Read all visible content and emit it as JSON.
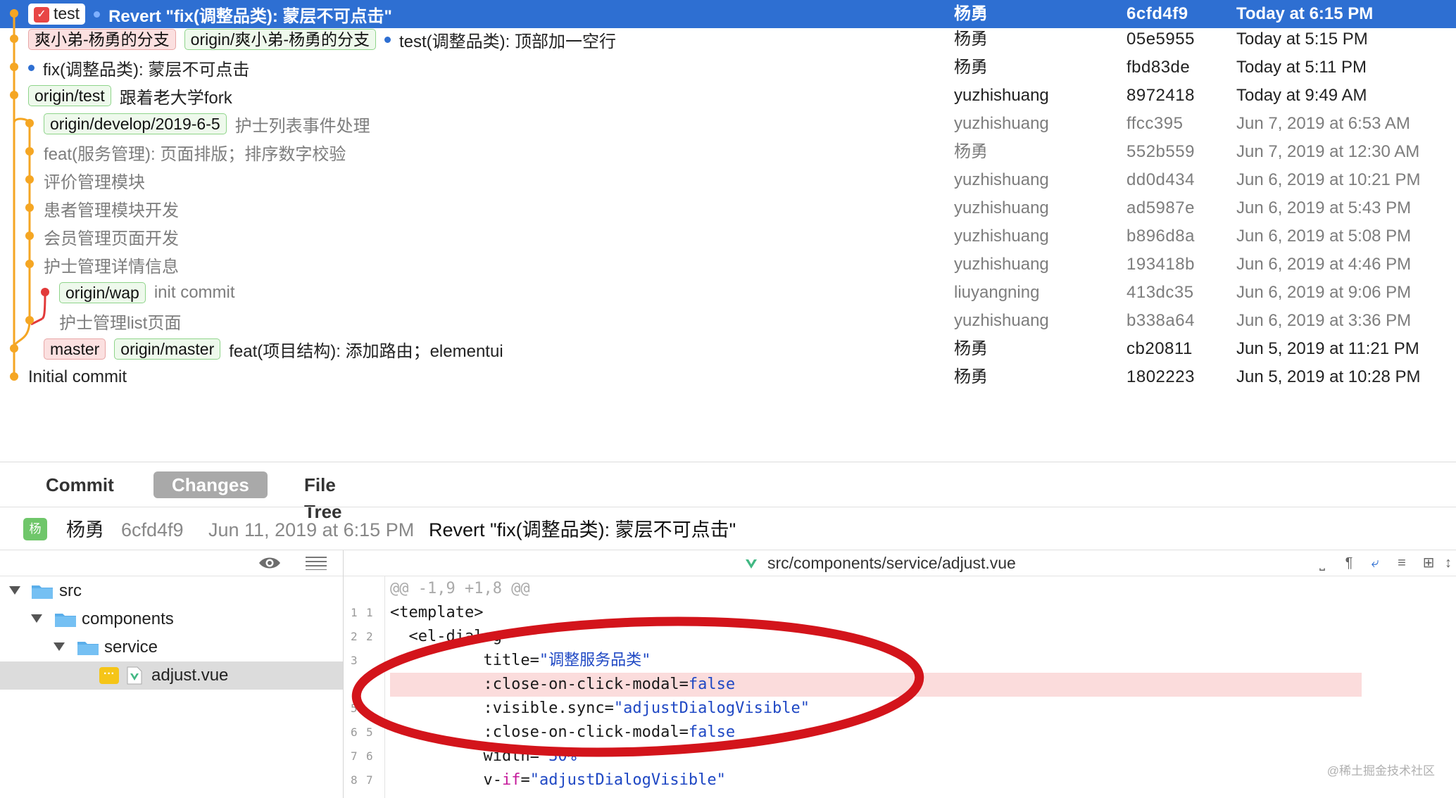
{
  "commits": [
    {
      "tags": [
        {
          "text": "test",
          "style": "white",
          "check": true
        }
      ],
      "bullet": true,
      "subject": "Revert \"fix(调整品类): 蒙层不可点击\"",
      "author": "杨勇",
      "hash": "6cfd4f9",
      "date": "Today at 6:15 PM"
    },
    {
      "tags": [
        {
          "text": "爽小弟-杨勇的分支",
          "style": "red"
        },
        {
          "text": "origin/爽小弟-杨勇的分支",
          "style": "green"
        }
      ],
      "bullet": true,
      "subject": "test(调整品类): 顶部加一空行",
      "author": "杨勇",
      "hash": "05e5955",
      "date": "Today at 5:15 PM"
    },
    {
      "tags": [],
      "bullet": true,
      "subject": "fix(调整品类): 蒙层不可点击",
      "author": "杨勇",
      "hash": "fbd83de",
      "date": "Today at 5:11 PM"
    },
    {
      "tags": [
        {
          "text": "origin/test",
          "style": "green"
        }
      ],
      "bullet": false,
      "subject": "跟着老大学fork",
      "author": "yuzhishuang",
      "hash": "8972418",
      "date": "Today at 9:49 AM"
    },
    {
      "tags": [
        {
          "text": "origin/develop/2019-6-5",
          "style": "green"
        }
      ],
      "bullet": false,
      "subject": "护士列表事件处理",
      "author": "yuzhishuang",
      "hash": "ffcc395",
      "date": "Jun 7, 2019 at 6:53 AM"
    },
    {
      "tags": [],
      "bullet": false,
      "subject": "feat(服务管理): 页面排版；排序数字校验",
      "author": "杨勇",
      "hash": "552b559",
      "date": "Jun 7, 2019 at 12:30 AM"
    },
    {
      "tags": [],
      "bullet": false,
      "subject": "评价管理模块",
      "author": "yuzhishuang",
      "hash": "dd0d434",
      "date": "Jun 6, 2019 at 10:21 PM"
    },
    {
      "tags": [],
      "bullet": false,
      "subject": "患者管理模块开发",
      "author": "yuzhishuang",
      "hash": "ad5987e",
      "date": "Jun 6, 2019 at 5:43 PM"
    },
    {
      "tags": [],
      "bullet": false,
      "subject": "会员管理页面开发",
      "author": "yuzhishuang",
      "hash": "b896d8a",
      "date": "Jun 6, 2019 at 5:08 PM"
    },
    {
      "tags": [],
      "bullet": false,
      "subject": "护士管理详情信息",
      "author": "yuzhishuang",
      "hash": "193418b",
      "date": "Jun 6, 2019 at 4:46 PM"
    },
    {
      "tags": [
        {
          "text": "origin/wap",
          "style": "green"
        }
      ],
      "bullet": false,
      "subject": "init commit",
      "author": "liuyangning",
      "hash": "413dc35",
      "date": "Jun 6, 2019 at 9:06 PM"
    },
    {
      "tags": [],
      "bullet": false,
      "subject": "护士管理list页面",
      "author": "yuzhishuang",
      "hash": "b338a64",
      "date": "Jun 6, 2019 at 3:36 PM"
    },
    {
      "tags": [
        {
          "text": "master",
          "style": "red"
        },
        {
          "text": "origin/master",
          "style": "green"
        }
      ],
      "bullet": false,
      "subject": "feat(项目结构): 添加路由；elementui",
      "author": "杨勇",
      "hash": "cb20811",
      "date": "Jun 5, 2019 at 11:21 PM"
    },
    {
      "tags": [],
      "bullet": false,
      "subject": "Initial commit",
      "author": "杨勇",
      "hash": "1802223",
      "date": "Jun 5, 2019 at 10:28 PM"
    }
  ],
  "tabs": {
    "commit": "Commit",
    "changes": "Changes",
    "file_tree": "File Tree"
  },
  "commit_header": {
    "avatar": "杨",
    "author": "杨勇",
    "hash": "6cfd4f9",
    "date": "Jun 11, 2019 at 6:15 PM",
    "message": "Revert \"fix(调整品类): 蒙层不可点击\""
  },
  "tree": {
    "src": "src",
    "components": "components",
    "service": "service",
    "file": "adjust.vue"
  },
  "diff": {
    "path": "src/components/service/adjust.vue",
    "hunk": "@@ -1,9 +1,8 @@",
    "lines": [
      {
        "old": "1",
        "new": "1",
        "type": "context",
        "segments": [
          {
            "t": "<template>",
            "c": "k"
          }
        ]
      },
      {
        "old": "2",
        "new": "2",
        "type": "context",
        "segments": [
          {
            "t": "  <el-dialog",
            "c": "k"
          }
        ]
      },
      {
        "old": "3",
        "new": "",
        "type": "context",
        "segments": [
          {
            "t": "          title=",
            "c": "k"
          },
          {
            "t": "\"调整服务品类\"",
            "c": "v"
          }
        ]
      },
      {
        "old": "",
        "new": "",
        "type": "removed",
        "segments": [
          {
            "t": "          :close-on-click-modal=",
            "c": "k"
          },
          {
            "t": "false",
            "c": "v"
          }
        ]
      },
      {
        "old": "5",
        "new": "",
        "type": "context",
        "segments": [
          {
            "t": "          :visible.sync=",
            "c": "k"
          },
          {
            "t": "\"adjustDialogVisible\"",
            "c": "v"
          }
        ]
      },
      {
        "old": "6",
        "new": "5",
        "type": "context",
        "segments": [
          {
            "t": "          :close-on-click-modal=",
            "c": "k"
          },
          {
            "t": "false",
            "c": "v"
          }
        ]
      },
      {
        "old": "7",
        "new": "6",
        "type": "context",
        "segments": [
          {
            "t": "          width=",
            "c": "k"
          },
          {
            "t": "\"30%\"",
            "c": "v"
          }
        ]
      },
      {
        "old": "8",
        "new": "7",
        "type": "context",
        "segments": [
          {
            "t": "          v-",
            "c": "k"
          },
          {
            "t": "if",
            "c": "kw"
          },
          {
            "t": "=",
            "c": "k"
          },
          {
            "t": "\"adjustDialogVisible\"",
            "c": "v"
          }
        ]
      }
    ]
  },
  "watermark": "@稀土掘金技术社区",
  "colors": {
    "selection": "#2e6fd2",
    "graph_main": "#f5a623",
    "graph_branch": "#e23a3a",
    "annotation": "#d3141b"
  }
}
